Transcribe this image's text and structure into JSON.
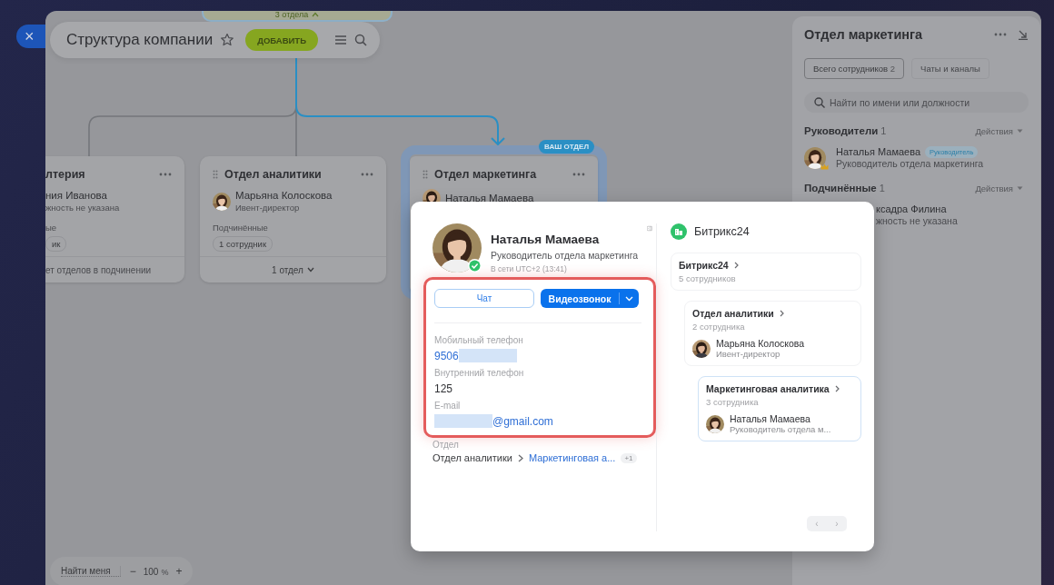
{
  "close_button": {
    "label": "×"
  },
  "header": {
    "title": "Структура компании",
    "favorite": false,
    "add_button": "ДОБАВИТЬ"
  },
  "org_chart": {
    "top_node": {
      "footer": "3 отдела",
      "expanded": true
    },
    "departments": [
      {
        "title": "лтерия",
        "head": {
          "name": "ния Иванова",
          "role": "жность не указана",
          "avatar": false
        },
        "subordinates_label": "ые",
        "subordinates": "ик",
        "footer": "ет отделов в подчинении",
        "expandable": false,
        "selected": false
      },
      {
        "title": "Отдел аналитики",
        "head": {
          "name": "Марьяна Колоскова",
          "role": "Ивент-директор",
          "avatar": true
        },
        "subordinates_label": "Подчинённые",
        "subordinates": "1 сотрудник",
        "footer": "1 отдел",
        "expandable": true,
        "selected": false
      },
      {
        "title": "Отдел маркетинга",
        "head": {
          "name": "Наталья Мамаева",
          "avatar": true
        },
        "badge": "ВАШ ОТДЕЛ",
        "selected": true
      }
    ]
  },
  "zoom_bar": {
    "find_me": "Найти меня",
    "minus": "−",
    "zoom": "100",
    "unit": "%",
    "plus": "+"
  },
  "side_panel": {
    "title": "Отдел маркетинга",
    "tabs": [
      {
        "label": "Всего сотрудников",
        "count": "2",
        "selected": true
      },
      {
        "label": "Чаты и каналы",
        "selected": false
      }
    ],
    "search": {
      "placeholder": "Найти по имени или должности"
    },
    "sections": [
      {
        "title": "Руководители",
        "count": "1",
        "actions": "Действия",
        "people": [
          {
            "name": "Наталья Мамаева",
            "tag": "Руководитель",
            "role": "Руководитель отдела маркетинга",
            "avatar": true,
            "head": true
          }
        ]
      },
      {
        "title": "Подчинённые",
        "count": "1",
        "actions": "Действия",
        "people": [
          {
            "name": "ксадра Филина",
            "role": "жность не указана",
            "avatar": false,
            "head": false
          }
        ]
      }
    ]
  },
  "profile_card": {
    "name": "Наталья Мамаева",
    "position": "Руководитель отдела маркетинга",
    "presence": "В сети",
    "timezone": "UTC+2 (13:41)",
    "online": true,
    "chat_button": "Чат",
    "call_button": "Видеозвонок",
    "highlighted": true,
    "fields": [
      {
        "label": "Мобильный телефон",
        "value": "9506",
        "kind": "phone"
      },
      {
        "label": "Внутренний телефон",
        "value": "125",
        "kind": "text"
      },
      {
        "label": "E-mail",
        "value": "@gmail.com",
        "kind": "email"
      }
    ],
    "department_label": "Отдел",
    "department_path": [
      "Отдел аналитики",
      "Маркетинговая а..."
    ],
    "more_count": "+1",
    "company": "Битрикс24",
    "structure": [
      {
        "title": "Битрикс24",
        "count": "5 сотрудников",
        "selected": false
      },
      {
        "title": "Отдел аналитики",
        "count": "2 сотрудника",
        "person": {
          "name": "Марьяна Колоскова",
          "role": "Ивент-директор"
        },
        "selected": false
      },
      {
        "title": "Маркетинговая аналитика",
        "count": "3 сотрудника",
        "person": {
          "name": "Наталья Мамаева",
          "role": "Руководитель отдела м..."
        },
        "selected": true
      }
    ],
    "pager": {
      "prev": "‹",
      "next": "›"
    }
  }
}
